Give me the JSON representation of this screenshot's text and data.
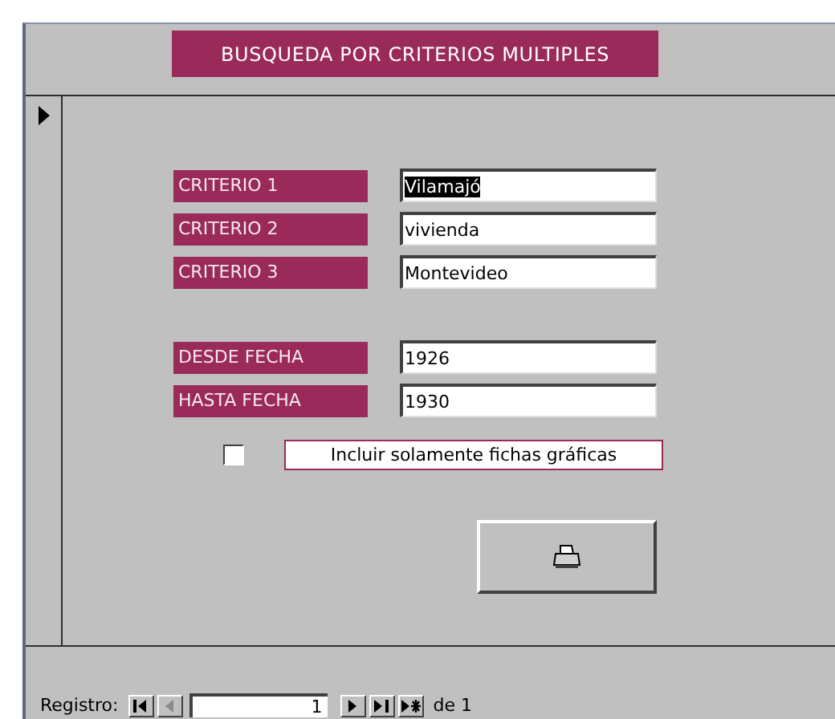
{
  "form": {
    "title": "BUSQUEDA POR CRITERIOS MULTIPLES",
    "criteria_fields": [
      {
        "label": "CRITERIO 1",
        "value": "Vilamajó",
        "selected": true
      },
      {
        "label": "CRITERIO 2",
        "value": "vivienda",
        "selected": false
      },
      {
        "label": "CRITERIO 3",
        "value": "Montevideo",
        "selected": false
      }
    ],
    "date_fields": [
      {
        "label": "DESDE FECHA",
        "value": "1926",
        "selected": false
      },
      {
        "label": "HASTA FECHA",
        "value": "1930",
        "selected": false
      }
    ],
    "graphics_only": {
      "label": "Incluir solamente fichas gráficas",
      "checked": false
    }
  },
  "navigation": {
    "label": "Registro:",
    "buttons": [
      {
        "kind": "first",
        "disabled": false
      },
      {
        "kind": "previous",
        "disabled": true
      }
    ],
    "current": "1",
    "buttons_after": [
      {
        "kind": "next",
        "disabled": false
      },
      {
        "kind": "last",
        "disabled": false
      },
      {
        "kind": "new",
        "disabled": false
      }
    ],
    "total": "de 1"
  }
}
